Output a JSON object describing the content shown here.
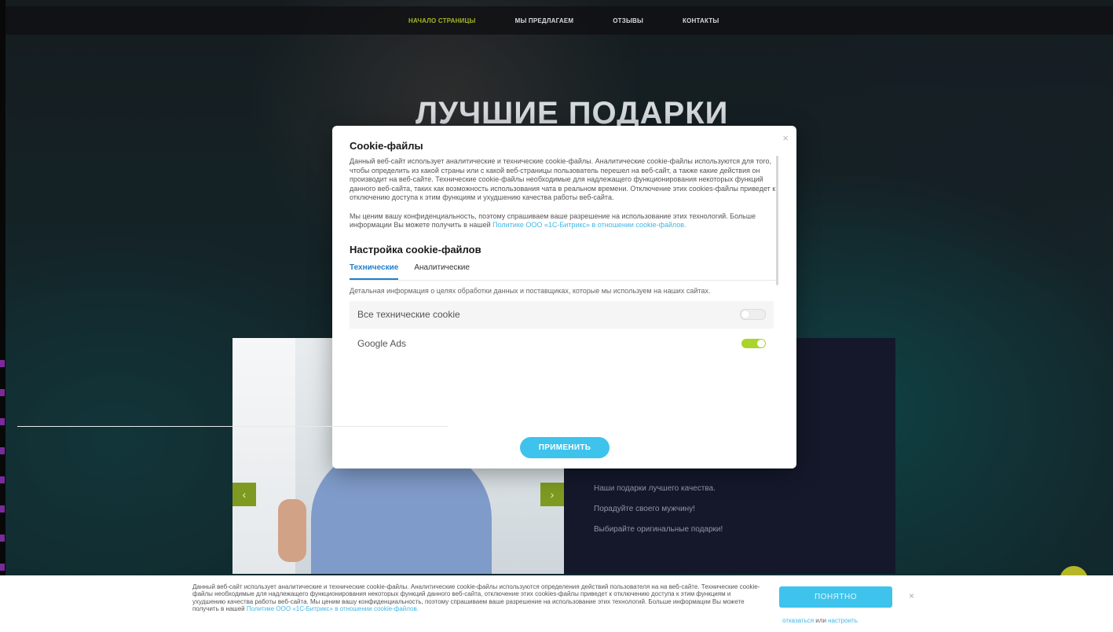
{
  "nav": {
    "items": [
      "НАЧАЛО СТРАНИЦЫ",
      "МЫ ПРЕДЛАГАЕМ",
      "ОТЗЫВЫ",
      "КОНТАКТЫ"
    ]
  },
  "hero": {
    "title": "ЛУЧШИЕ ПОДАРКИ"
  },
  "slider": {
    "prev": "‹",
    "next": "›",
    "lines": [
      "Наши подарки лучшего качества.",
      "Порадуйте своего мужчину!",
      "Выбирайте оригинальные подарки!"
    ]
  },
  "modal": {
    "close": "×",
    "title": "Cookie-файлы",
    "p1": "Данный веб-сайт использует аналитические и технические cookie-файлы. Аналитические cookie-файлы используются для того, чтобы определить из какой страны или с какой веб-страницы пользователь перешел на веб-сайт, а также какие действия он производит на веб-сайте. Технические cookie-файлы необходимые для надлежащего функционирования некоторых функций данного веб-сайта, таких как возможность использования чата в реальном времени. Отключение этих cookies-файлы приведет к отключению доступа к этим функциям и ухудшению качества работы веб-сайта.",
    "p2_text": "Мы ценим вашу конфиденциальность, поэтому спрашиваем ваше разрешение на использование этих технологий. Больше информации Вы можете получить в нашей ",
    "p2_link": "Политике ООО «1С-Битрикс» в отношении cookie-файлов.",
    "settings_title": "Настройка cookie-файлов",
    "tabs": [
      "Технические",
      "Аналитические"
    ],
    "tab_desc": "Детальная информация о целях обработки данных и поставщиках, которые мы используем на наших сайтах.",
    "rows": [
      {
        "label": "Все технические cookie",
        "enabled": false
      },
      {
        "label": "Google Ads",
        "enabled": true
      }
    ],
    "apply": "ПРИМЕНИТЬ"
  },
  "cookie_bar": {
    "text": "Данный веб-сайт использует аналитические и технические cookie-файлы. Аналитические cookie-файлы используются определения действий пользователя на на веб-сайте. Технические cookie-файлы необходимые для надлежащего функционирования некоторых функций данного веб-сайта, отключение этих cookies-файлы приведет к отключению доступа к этим функциям и ухудшению качества работы веб-сайта. Мы ценим вашу конфиденциальность, поэтому спрашиваем ваше разрешение на использование этих технологий. Больше информации Вы можете получить в нашей ",
    "link": "Политике ООО «1С-Битрикс» в отношении cookie-файлов.",
    "ok": "ПОНЯТНО",
    "close": "×",
    "refuse": "отказаться",
    "or": " или ",
    "configure": "настроить"
  },
  "colors": {
    "accent_blue": "#3ec3ec",
    "nav_active": "#a7b52b",
    "toggle_on": "#a8d42b",
    "tab_active": "#1e7fcf"
  }
}
